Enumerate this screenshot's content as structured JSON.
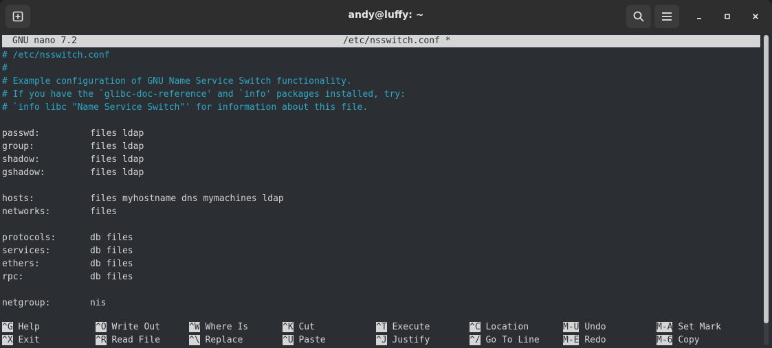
{
  "window": {
    "title": "andy@luffy: ~"
  },
  "nano": {
    "app": "GNU nano 7.2",
    "file": "/etc/nsswitch.conf *"
  },
  "comments": [
    "# /etc/nsswitch.conf",
    "#",
    "# Example configuration of GNU Name Service Switch functionality.",
    "# If you have the `glibc-doc-reference' and `info' packages installed, try:",
    "# `info libc \"Name Service Switch\"' for information about this file."
  ],
  "entries": [
    {
      "key": "passwd:",
      "value": "files ldap"
    },
    {
      "key": "group:",
      "value": "files ldap"
    },
    {
      "key": "shadow:",
      "value": "files ldap"
    },
    {
      "key": "gshadow:",
      "value": "files ldap"
    },
    {
      "key": "hosts:",
      "value": "files myhostname dns mymachines ldap"
    },
    {
      "key": "networks:",
      "value": "files"
    },
    {
      "key": "protocols:",
      "value": "db files"
    },
    {
      "key": "services:",
      "value": "db files"
    },
    {
      "key": "ethers:",
      "value": "db files"
    },
    {
      "key": "rpc:",
      "value": "db files"
    },
    {
      "key": "netgroup:",
      "value": "nis"
    }
  ],
  "shortcuts": {
    "row1": [
      {
        "key": "^G",
        "label": "Help"
      },
      {
        "key": "^O",
        "label": "Write Out"
      },
      {
        "key": "^W",
        "label": "Where Is"
      },
      {
        "key": "^K",
        "label": "Cut"
      },
      {
        "key": "^T",
        "label": "Execute"
      },
      {
        "key": "^C",
        "label": "Location"
      },
      {
        "key": "M-U",
        "label": "Undo"
      },
      {
        "key": "M-A",
        "label": "Set Mark"
      }
    ],
    "row2": [
      {
        "key": "^X",
        "label": "Exit"
      },
      {
        "key": "^R",
        "label": "Read File"
      },
      {
        "key": "^\\",
        "label": "Replace"
      },
      {
        "key": "^U",
        "label": "Paste"
      },
      {
        "key": "^J",
        "label": "Justify"
      },
      {
        "key": "^/",
        "label": "Go To Line"
      },
      {
        "key": "M-E",
        "label": "Redo"
      },
      {
        "key": "M-6",
        "label": "Copy"
      }
    ]
  },
  "icons": {
    "new_tab": "plus-in-square-icon",
    "search": "search-icon",
    "menu": "hamburger-menu-icon",
    "minimize": "minimize-icon",
    "maximize": "maximize-icon",
    "close": "close-icon"
  },
  "colors": {
    "terminal_bg": "#2b2f33",
    "comment": "#2ea7c6",
    "text": "#d6d6d6",
    "titlebar": "#2e2e2e"
  }
}
